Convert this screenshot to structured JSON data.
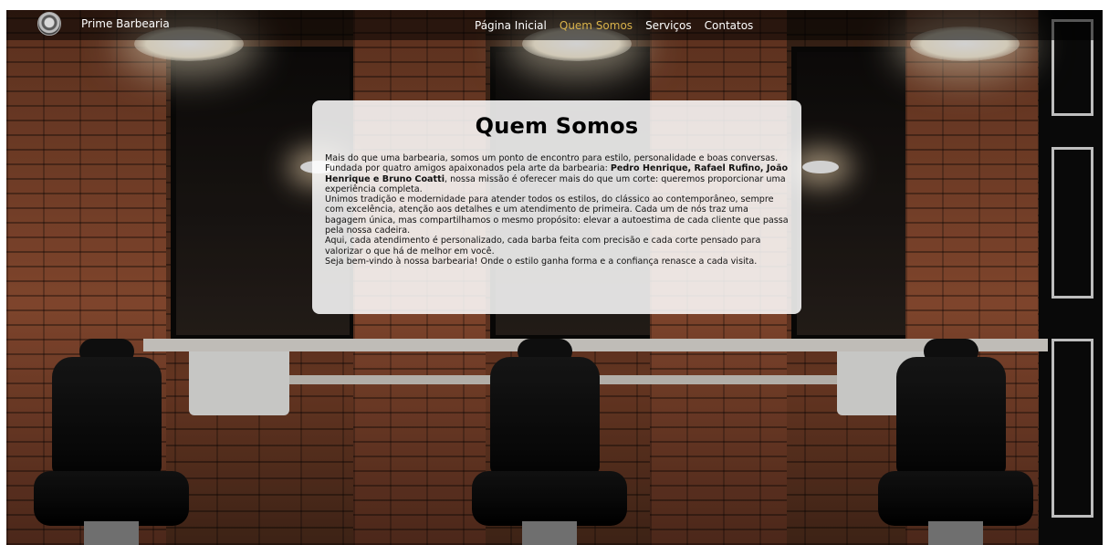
{
  "nav": {
    "brand": "Prime Barbearia",
    "logo_icon": "barber-skull-logo-icon",
    "items": [
      {
        "label": "Página Inicial",
        "active": false
      },
      {
        "label": "Quem Somos",
        "active": true
      },
      {
        "label": "Serviços",
        "active": false
      },
      {
        "label": "Contatos",
        "active": false
      }
    ],
    "active_color": "#d9b24a"
  },
  "about": {
    "title": "Quem Somos",
    "p1_pre": "Mais do que uma barbearia, somos um ponto de encontro para estilo, personalidade e boas conversas. Fundada por quatro amigos apaixonados pela arte da barbearia: ",
    "founders": "Pedro Henrique, Rafael Rufino, João Henrique e Bruno Coatti",
    "p1_post": ", nossa missão é oferecer mais do que um corte: queremos proporcionar uma experiência completa.",
    "p2": "Unimos tradição e modernidade para atender todos os estilos, do clássico ao contemporâneo, sempre com excelência, atenção aos detalhes e um atendimento de primeira. Cada um de nós traz uma bagagem única, mas compartilhamos o mesmo propósito: elevar a autoestima de cada cliente que passa pela nossa cadeira.",
    "p3": "Aqui, cada atendimento é personalizado, cada barba feita com precisão e cada corte pensado para valorizar o que há de melhor em você.",
    "p4": "Seja bem-vindo à nossa barbearia! Onde o estilo ganha forma e a confiança renasce a cada visita."
  }
}
